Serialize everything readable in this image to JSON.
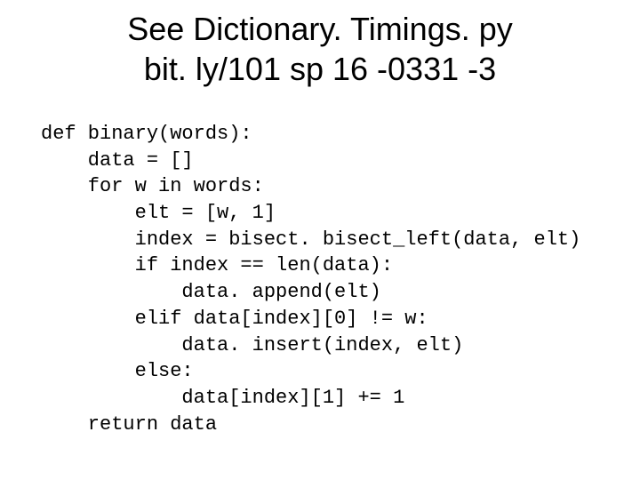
{
  "title_line1": "See Dictionary. Timings. py",
  "title_line2": "bit. ly/101 sp 16 -0331 -3",
  "code": "def binary(words):\n    data = []\n    for w in words:\n        elt = [w, 1]\n        index = bisect. bisect_left(data, elt)\n        if index == len(data):\n            data. append(elt)\n        elif data[index][0] != w:\n            data. insert(index, elt)\n        else:\n            data[index][1] += 1\n    return data"
}
